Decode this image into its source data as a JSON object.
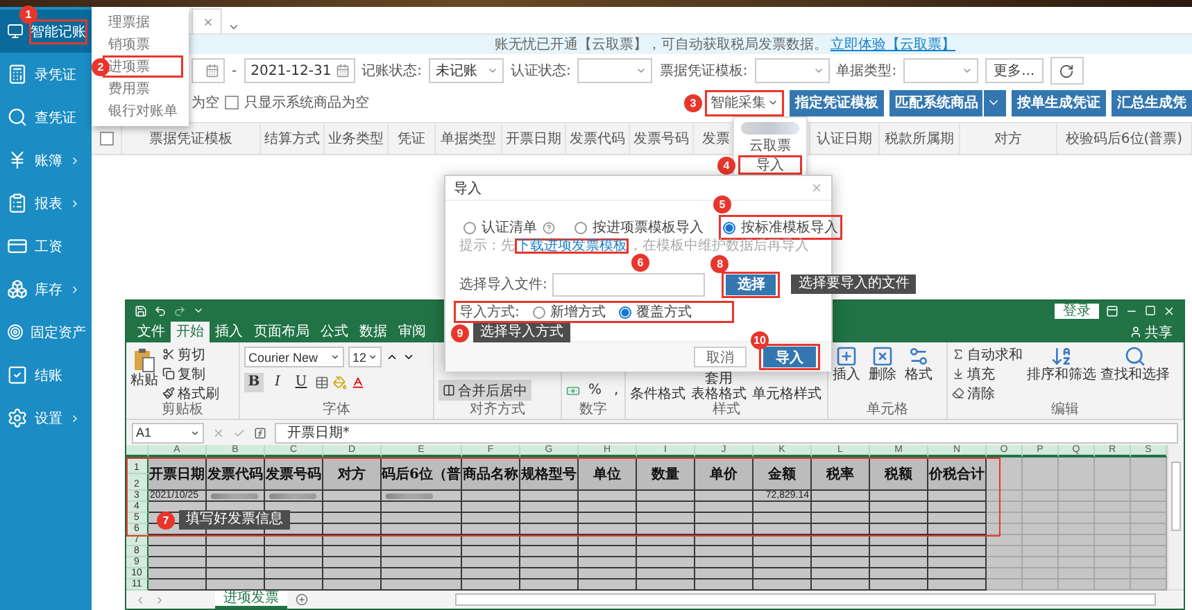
{
  "sidebar": {
    "items": [
      {
        "label": "智能记账",
        "selected": true,
        "arrow": false,
        "highlighted": true,
        "callout": "1"
      },
      {
        "label": "录凭证",
        "selected": false,
        "arrow": false,
        "highlighted": false
      },
      {
        "label": "查凭证",
        "selected": false,
        "arrow": false,
        "highlighted": false
      },
      {
        "label": "账簿",
        "selected": false,
        "arrow": true,
        "highlighted": false
      },
      {
        "label": "报表",
        "selected": false,
        "arrow": true,
        "highlighted": false
      },
      {
        "label": "工资",
        "selected": false,
        "arrow": false,
        "highlighted": false
      },
      {
        "label": "库存",
        "selected": false,
        "arrow": true,
        "highlighted": false
      },
      {
        "label": "固定资产",
        "selected": false,
        "arrow": false,
        "highlighted": false
      },
      {
        "label": "结账",
        "selected": false,
        "arrow": false,
        "highlighted": false
      },
      {
        "label": "设置",
        "selected": false,
        "arrow": true,
        "highlighted": false
      }
    ]
  },
  "submenu": {
    "items": [
      {
        "label": "理票据",
        "highlighted": false
      },
      {
        "label": "销项票",
        "highlighted": false
      },
      {
        "label": "进项票",
        "highlighted": true,
        "callout": "2"
      },
      {
        "label": "费用票",
        "highlighted": false
      },
      {
        "label": "银行对账单",
        "highlighted": false
      }
    ]
  },
  "banner": {
    "text": "账无忧已开通【云取票】，可自动获取税局发票数据。",
    "link": "立即体验【云取票】"
  },
  "filters": {
    "separator": "-",
    "date_end": "2021-12-31",
    "selects": [
      {
        "label": "记账状态:",
        "value": "未记账"
      },
      {
        "label": "认证状态:"
      },
      {
        "label": "票据凭证模板:"
      },
      {
        "label": "单据类型:"
      }
    ],
    "more": "更多..."
  },
  "options": {
    "partial_label": "为空",
    "checkbox": {
      "label": "只显示系统商品为空",
      "checked": false
    }
  },
  "toolbar": {
    "collect": {
      "label": "智能采集",
      "highlighted": true,
      "callout": "3"
    },
    "buttons": [
      {
        "label": "指定凭证模板",
        "split": false
      },
      {
        "label": "匹配系统商品",
        "split": true
      },
      {
        "label": "按单生成凭证",
        "split": false
      },
      {
        "label": "汇总生成凭",
        "split": false
      }
    ]
  },
  "collect_menu": {
    "items": [
      {
        "kind": "blurred"
      },
      {
        "kind": "item",
        "label": "云取票",
        "highlighted": false
      },
      {
        "kind": "item",
        "label": "导入",
        "highlighted": true,
        "callout": "4"
      }
    ]
  },
  "table": {
    "select_all": false,
    "columns": [
      "票据凭证模板",
      "结算方式",
      "业务类型",
      "凭证",
      "单据类型",
      "开票日期",
      "发票代码",
      "发票号码",
      "发票",
      "认证日期",
      "税款所属期",
      "对方",
      "校验码后6位(普票)"
    ]
  },
  "excel": {
    "login": "登录",
    "share": "共享",
    "tabs": [
      {
        "label": "文件",
        "selected": false
      },
      {
        "label": "开始",
        "selected": true
      },
      {
        "label": "插入",
        "selected": false
      },
      {
        "label": "页面布局",
        "selected": false
      },
      {
        "label": "公式",
        "selected": false
      },
      {
        "label": "数据",
        "selected": false
      },
      {
        "label": "审阅",
        "selected": false
      }
    ],
    "ribbon": {
      "paste": "粘贴",
      "clipboard_items": [
        "剪切",
        "复制",
        "格式刷"
      ],
      "clipboard": "剪贴板",
      "font_name": "Courier New",
      "font_size": "12",
      "font_buttons": [
        "B",
        "I",
        "U"
      ],
      "font": "字体",
      "merge": "合并后居中",
      "alignment": "对齐方式",
      "number_buttons": [
        "%",
        ","
      ],
      "number": "数字",
      "styles_items": [
        [
          "条件格式"
        ],
        [
          "套用",
          "表格格式"
        ],
        [
          "单元格样式"
        ]
      ],
      "styles": "样式",
      "cells_items": [
        "插入",
        "删除",
        "格式"
      ],
      "cells": "单元格",
      "edit_items": [
        "自动求和",
        "填充",
        "清除"
      ],
      "edit_big": [
        "排序和筛选",
        "查找和选择"
      ],
      "editing": "编辑"
    },
    "name_box": "A1",
    "formula": "开票日期*",
    "columns": [
      "A",
      "B",
      "C",
      "D",
      "E",
      "F",
      "G",
      "H",
      "I",
      "J",
      "K",
      "L",
      "M",
      "N",
      "O",
      "P",
      "Q",
      "R",
      "S"
    ],
    "headers": [
      "开票日期",
      "发票代码",
      "发票号码",
      "对方",
      "码后6位（普",
      "商品名称",
      "规格型号",
      "单位",
      "数量",
      "单价",
      "金额",
      "税率",
      "税额",
      "价税合计"
    ],
    "row_numbers": [
      "1",
      "2",
      "3",
      "4",
      "5",
      "6",
      "7",
      "8",
      "9",
      "10",
      "11"
    ],
    "rows": [
      [
        {
          "kind": "text",
          "value": "2021/10/25"
        },
        {
          "kind": "blurred"
        },
        {
          "kind": "blurred"
        },
        {
          "kind": "empty"
        },
        {
          "kind": "blurred"
        },
        {
          "kind": "empty"
        },
        {
          "kind": "empty"
        },
        {
          "kind": "empty"
        },
        {
          "kind": "empty"
        },
        {
          "kind": "empty"
        },
        {
          "kind": "number",
          "value": "72,829.14"
        }
      ]
    ],
    "grid_callout": {
      "number": "7",
      "note": "填写好发票信息"
    },
    "sheet_tab": "进项发票"
  },
  "dialog": {
    "title": "导入",
    "sources": [
      {
        "label": "认证清单",
        "help": true,
        "selected": false,
        "highlighted": false
      },
      {
        "label": "按进项票模板导入",
        "selected": false,
        "highlighted": false
      },
      {
        "label": "按标准模板导入",
        "selected": true,
        "highlighted": true,
        "callout": "5"
      }
    ],
    "hint_prefix": "提示：先",
    "hint_link": "下载进项发票模板",
    "hint_suffix": "，在模板中维护数据后再导入",
    "hint_callout": "6",
    "file_label": "选择导入文件:",
    "choose_button": "选择",
    "choose_callout": {
      "number": "8",
      "note": "选择要导入的文件"
    },
    "mode_label": "导入方式:",
    "modes": [
      {
        "label": "新增方式",
        "selected": false
      },
      {
        "label": "覆盖方式",
        "selected": true
      }
    ],
    "mode_callout": {
      "number": "9",
      "note": "选择导入方式"
    },
    "buttons": [
      {
        "label": "取消",
        "kind": "secondary",
        "highlighted": false
      },
      {
        "label": "导入",
        "kind": "primary",
        "highlighted": true,
        "callout": "10"
      }
    ]
  }
}
